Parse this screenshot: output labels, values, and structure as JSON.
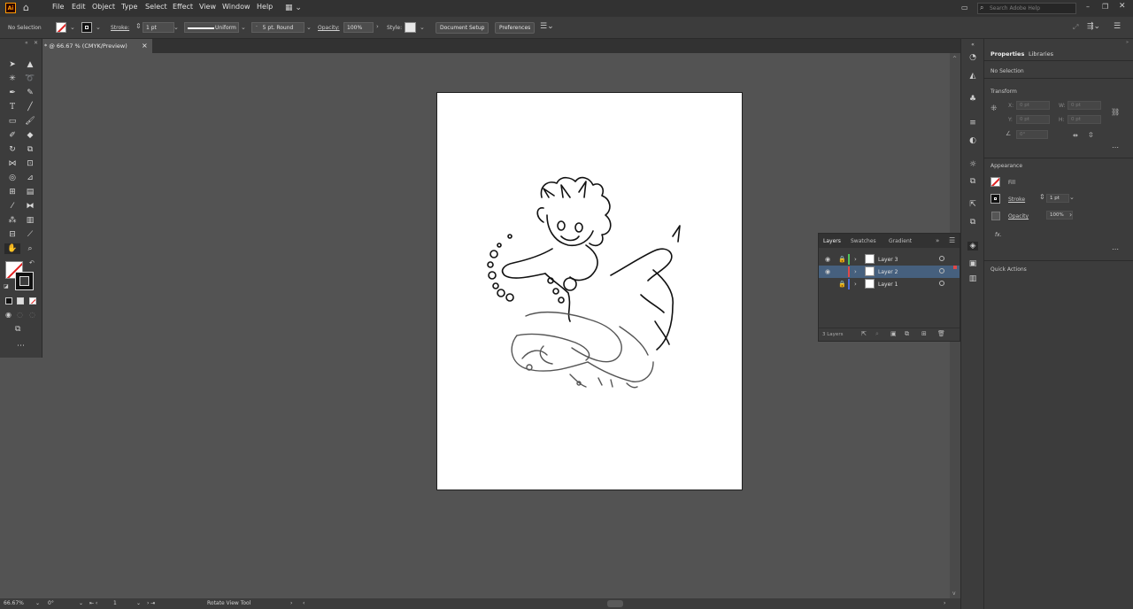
{
  "menubar": {
    "app_logo": "Ai",
    "items": [
      "File",
      "Edit",
      "Object",
      "Type",
      "Select",
      "Effect",
      "View",
      "Window",
      "Help"
    ],
    "search_placeholder": "Search Adobe Help"
  },
  "control": {
    "selection": "No Selection",
    "stroke_label": "Stroke:",
    "stroke_weight": "1 pt",
    "profile": "Uniform",
    "brush": "5 pt. Round",
    "opacity_label": "Opacity:",
    "opacity_value": "100%",
    "style_label": "Style:",
    "doc_setup": "Document Setup",
    "preferences": "Preferences"
  },
  "document": {
    "tab_title": "* @ 66.67 % (CMYK/Preview)",
    "close": "×"
  },
  "status": {
    "zoom": "66.67%",
    "rotation": "0°",
    "artboard": "1",
    "tool": "Rotate View Tool"
  },
  "properties": {
    "tabs": [
      "Properties",
      "Libraries"
    ],
    "selection": "No Selection",
    "transform_title": "Transform",
    "x_label": "X:",
    "y_label": "Y:",
    "w_label": "W:",
    "h_label": "H:",
    "x_value": "0 pt",
    "y_value": "0 pt",
    "w_value": "0 pt",
    "h_value": "0 pt",
    "angle_value": "0°",
    "appearance_title": "Appearance",
    "fill_label": "Fill",
    "stroke_label": "Stroke",
    "stroke_weight": "1 pt",
    "opacity_label": "Opacity",
    "opacity_value": "100%",
    "fx": "fx.",
    "quick_actions": "Quick Actions"
  },
  "layers": {
    "tabs": [
      "Layers",
      "Swatches",
      "Gradient"
    ],
    "rows": [
      {
        "name": "Layer 3",
        "color": "#4fc35a"
      },
      {
        "name": "Layer 2",
        "color": "#e04848"
      },
      {
        "name": "Layer 1",
        "color": "#4a6bd8"
      }
    ],
    "count": "3 Layers"
  }
}
